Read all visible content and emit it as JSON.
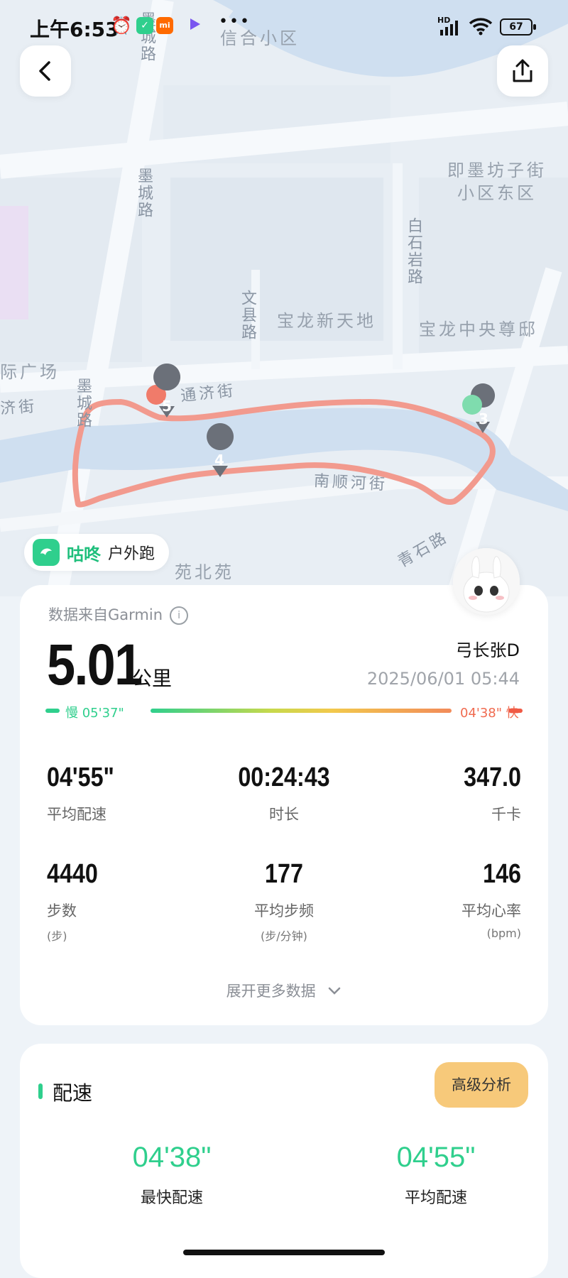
{
  "status_bar": {
    "time": "上午6:53",
    "battery": "67",
    "network": "HD"
  },
  "map": {
    "labels": {
      "xinhe": "信合小区",
      "mocheng_1": "墨城路",
      "mocheng_2": "墨城路",
      "mocheng_3": "墨城路",
      "jimo_1": "即墨坊子街",
      "jimo_2": "小区东区",
      "baishiyan": "白石岩路",
      "wenxian": "文县路",
      "baolong": "宝龙新天地",
      "baolong_central": "宝龙中央尊邸",
      "tongji": "通济街",
      "nanshunhe": "南顺河街",
      "qingshi": "青石路",
      "guangchang": "际广场",
      "jiejie": "济街",
      "beiyuan": "苑北苑"
    },
    "markers": [
      "5",
      "4",
      "3"
    ]
  },
  "brand": {
    "name": "咕咚",
    "activity": "户外跑"
  },
  "summary": {
    "source": "数据来自Garmin",
    "distance": "5.01",
    "distance_unit": "公里",
    "username": "弓长张D",
    "datetime": "2025/06/01 05:44",
    "slow_label": "慢 05'37\"",
    "fast_label": "04'38\" 快"
  },
  "stats": {
    "avg_pace": {
      "value": "04'55\"",
      "label": "平均配速"
    },
    "duration": {
      "value": "00:24:43",
      "label": "时长"
    },
    "calories": {
      "value": "347.0",
      "label": "千卡"
    },
    "steps": {
      "value": "4440",
      "label": "步数",
      "unit": "(步)"
    },
    "cadence": {
      "value": "177",
      "label": "平均步频",
      "unit": "(步/分钟)"
    },
    "heart_rate": {
      "value": "146",
      "label": "平均心率",
      "unit": "(bpm)"
    }
  },
  "expand_label": "展开更多数据",
  "pace_section": {
    "title": "配速",
    "advanced_button": "高级分析",
    "fastest": {
      "value": "04'38\"",
      "label": "最快配速"
    },
    "average": {
      "value": "04'55\"",
      "label": "平均配速"
    }
  },
  "colors": {
    "accent_green": "#2fcf8d",
    "route": "#f29a8e",
    "river": "#cfdff0",
    "advanced_button": "#f7c97a"
  }
}
